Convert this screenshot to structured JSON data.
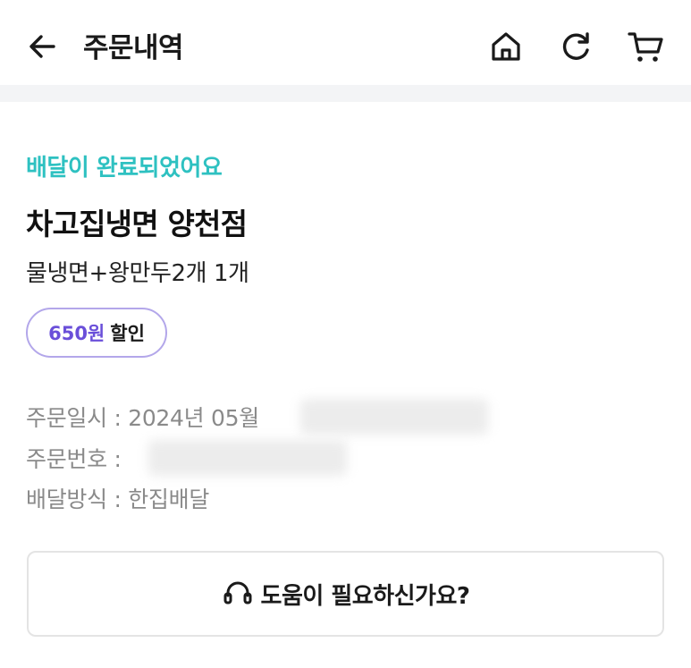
{
  "header": {
    "title": "주문내역",
    "icons": {
      "back": "arrow-left-icon",
      "home": "home-icon",
      "refresh": "refresh-icon",
      "cart": "cart-icon"
    }
  },
  "order": {
    "status": "배달이 완료되었어요",
    "store_name": "차고집냉면 양천점",
    "menu_summary": "물냉면+왕만두2개 1개",
    "discount": {
      "amount": "650원",
      "label": "할인"
    },
    "details": {
      "date_label": "주문일시 : 2024년 05월",
      "number_label": "주문번호 :",
      "method_label": "배달방식 : 한집배달"
    }
  },
  "help": {
    "label": "도움이 필요하신가요?",
    "icon": "headset-icon"
  },
  "colors": {
    "status_accent": "#2ec1c1",
    "discount_accent": "#6a4fd9",
    "badge_border": "#b3a7ea"
  }
}
